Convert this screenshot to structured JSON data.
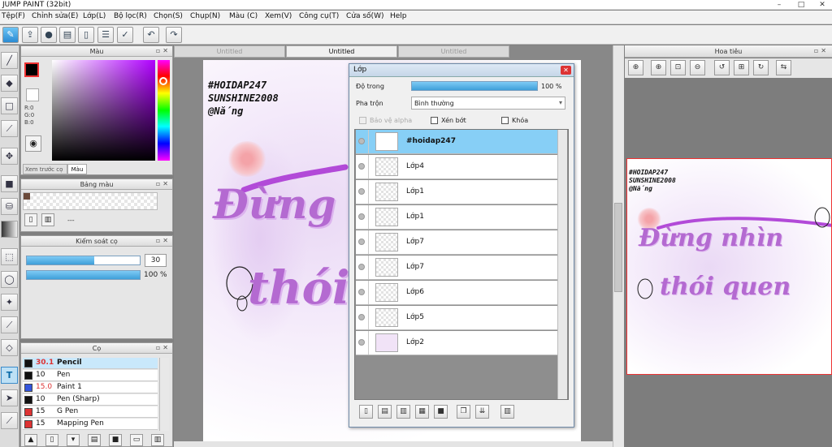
{
  "window": {
    "title": "JUMP PAINT (32bit)",
    "minimize": "–",
    "maximize": "□",
    "close": "✕"
  },
  "menu": [
    "Tệp(F)",
    "Chỉnh sửa(E)",
    "Lớp(L)",
    "Bộ lọc(R)",
    "Chọn(S)",
    "Chụp(N)",
    "Màu (C)",
    "Xem(V)",
    "Công cụ(T)",
    "Cửa số(W)",
    "Help"
  ],
  "toolbar_icons": [
    "pen-nib-icon",
    "share-icon",
    "comment-icon",
    "note-icon",
    "document-icon",
    "settings-list-icon",
    "checklist-icon",
    "undo-icon",
    "redo-icon"
  ],
  "left_tools": [
    "brush-icon",
    "eraser-icon",
    "rect-select-icon",
    "pencil-line-icon",
    "move-icon",
    "fill-rect-icon",
    "bucket-icon",
    "gradient-icon",
    "marquee-icon",
    "lasso-icon",
    "magic-wand-icon",
    "select-pen-icon",
    "select-eraser-icon",
    "text-icon",
    "pointer-icon",
    "dropper-icon"
  ],
  "color_panel": {
    "title": "Màu",
    "r": "R:0",
    "g": "G:0",
    "b": "B:0",
    "tab_preview": "Xem trước cọ",
    "tab_color": "Màu",
    "primary": "#000000",
    "secondary": "#ffffff"
  },
  "swatch_panel": {
    "title": "Bảng màu",
    "dash": "---",
    "swatch_color": "#6b4a3a"
  },
  "brush_control": {
    "title": "Kiểm soát cọ",
    "size": "30",
    "size_fill": 0.6,
    "opacity": "100 %",
    "opacity_fill": 1.0
  },
  "brush_panel": {
    "title": "Cọ",
    "items": [
      {
        "size": "30.1",
        "name": "Pencil",
        "color": "#111111",
        "selected": true
      },
      {
        "size": "10",
        "name": "Pen",
        "color": "#111111",
        "selected": false
      },
      {
        "size": "15.0",
        "name": "Paint 1",
        "color": "#3355dd",
        "selected": false
      },
      {
        "size": "10",
        "name": "Pen (Sharp)",
        "color": "#111111",
        "selected": false
      },
      {
        "size": "15",
        "name": "G Pen",
        "color": "#dd3333",
        "selected": false
      },
      {
        "size": "15",
        "name": "Mapping Pen",
        "color": "#dd3333",
        "selected": false
      }
    ]
  },
  "canvas_tabs": [
    "Untitled",
    "Untitled",
    "Untitled"
  ],
  "artwork": {
    "line1": "#HOIDAP247",
    "line2": "SUNSHINE2008",
    "line3": "@Nắng",
    "script1": "Đừng",
    "script2": "thói",
    "preview_script1": "Đừng nhìn",
    "preview_script2": "thói quen"
  },
  "layer_window": {
    "title": "Lớp",
    "opacity_label": "Độ trong",
    "opacity_value": "100 %",
    "opacity_fill": 1.0,
    "blend_label": "Pha trộn",
    "blend_value": "Bình thường",
    "protect_alpha": "Bảo vệ alpha",
    "clip": "Xén bớt",
    "lock": "Khóa",
    "layers": [
      {
        "name": "#hoidap247",
        "selected": true
      },
      {
        "name": "Lớp4",
        "selected": false
      },
      {
        "name": "Lớp1",
        "selected": false
      },
      {
        "name": "Lớp1",
        "selected": false
      },
      {
        "name": "Lớp7",
        "selected": false
      },
      {
        "name": "Lớp7",
        "selected": false
      },
      {
        "name": "Lớp6",
        "selected": false
      },
      {
        "name": "Lớp5",
        "selected": false
      },
      {
        "name": "Lớp2",
        "selected": false
      }
    ]
  },
  "navigator": {
    "title": "Hoa tiêu"
  },
  "colors": {
    "accent": "#87cff6",
    "selection_border": "#ee3333",
    "script_purple": "#b46ad1"
  }
}
